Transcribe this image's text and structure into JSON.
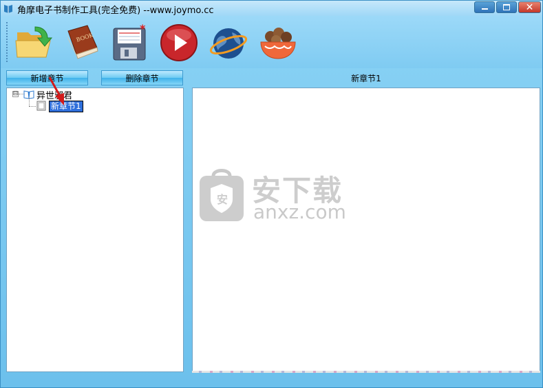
{
  "window": {
    "title": "角摩电子书制作工具(完全免费) --www.joymo.cc",
    "minimize_icon": "minimize-icon",
    "maximize_icon": "maximize-icon",
    "close_icon": "close-icon"
  },
  "toolbar": {
    "items": [
      {
        "icon": "open-folder-icon"
      },
      {
        "icon": "book-icon"
      },
      {
        "icon": "save-icon"
      },
      {
        "icon": "play-icon"
      },
      {
        "icon": "globe-icon"
      },
      {
        "icon": "bowl-icon"
      }
    ]
  },
  "chapter_buttons": {
    "add_label": "新增章节",
    "delete_label": "删除章节"
  },
  "tree": {
    "root_label": "异世邪君",
    "expander": "⊟",
    "child_label": "新章节1"
  },
  "editor": {
    "title": "新章节1"
  },
  "watermark": {
    "text": "安下载",
    "url": "anxz.com"
  },
  "colors": {
    "accent": "#7cc9f0",
    "selection": "#2f6fdb"
  }
}
